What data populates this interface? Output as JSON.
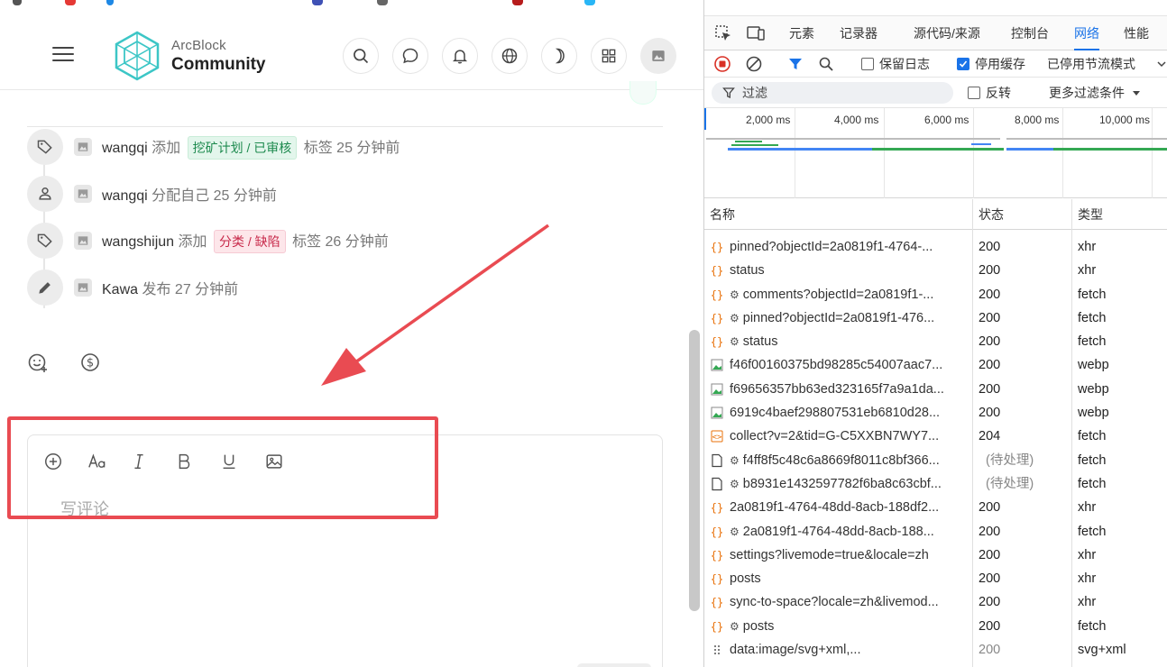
{
  "header": {
    "logo_line1": "ArcBlock",
    "logo_line2": "Community"
  },
  "activity": [
    {
      "icon": "tag-icon",
      "user": "wangqi",
      "before": " 添加 ",
      "tag": "挖矿计划 / 已审核",
      "tag_color": "green",
      "after": " 标签 25 分钟前"
    },
    {
      "icon": "person-icon",
      "user": "wangqi",
      "before": " 分配自己 25 分钟前",
      "tag": "",
      "tag_color": "",
      "after": ""
    },
    {
      "icon": "tag-icon",
      "user": "wangshijun",
      "before": " 添加 ",
      "tag": "分类 / 缺陷",
      "tag_color": "red",
      "after": " 标签 26 分钟前"
    },
    {
      "icon": "pencil-icon",
      "user": "Kawa",
      "before": " 发布 27 分钟前",
      "tag": "",
      "tag_color": "",
      "after": ""
    }
  ],
  "editor": {
    "placeholder": "写评论"
  },
  "devtools": {
    "tabs": [
      "元素",
      "记录器",
      "源代码/来源",
      "控制台",
      "网络",
      "性能"
    ],
    "active_tab": "网络",
    "toolbar": {
      "preserve_log": "保留日志",
      "preserve_log_checked": false,
      "disable_cache": "停用缓存",
      "disable_cache_checked": true,
      "throttling": "已停用节流模式"
    },
    "filter": {
      "placeholder": "过滤",
      "invert": "反转",
      "more_filters": "更多过滤条件"
    },
    "timeline_ticks": [
      "2,000 ms",
      "4,000 ms",
      "6,000 ms",
      "8,000 ms",
      "10,000 ms"
    ],
    "columns": [
      "名称",
      "状态",
      "类型"
    ],
    "requests": [
      {
        "icon": "xhr",
        "gear": false,
        "name": "pinned?objectId=2a0819f1-4764-...",
        "status": "200",
        "type": "xhr"
      },
      {
        "icon": "xhr",
        "gear": false,
        "name": "status",
        "status": "200",
        "type": "xhr"
      },
      {
        "icon": "xhr",
        "gear": true,
        "name": "comments?objectId=2a0819f1-...",
        "status": "200",
        "type": "fetch"
      },
      {
        "icon": "xhr",
        "gear": true,
        "name": "pinned?objectId=2a0819f1-476...",
        "status": "200",
        "type": "fetch"
      },
      {
        "icon": "xhr",
        "gear": true,
        "name": "status",
        "status": "200",
        "type": "fetch"
      },
      {
        "icon": "image",
        "gear": false,
        "name": "f46f00160375bd98285c54007aac7...",
        "status": "200",
        "type": "webp"
      },
      {
        "icon": "image",
        "gear": false,
        "name": "f69656357bb63ed323165f7a9a1da...",
        "status": "200",
        "type": "webp"
      },
      {
        "icon": "image",
        "gear": false,
        "name": "6919c4baef298807531eb6810d28...",
        "status": "200",
        "type": "webp"
      },
      {
        "icon": "script",
        "gear": false,
        "name": "collect?v=2&tid=G-C5XXBN7WY7...",
        "status": "204",
        "type": "fetch"
      },
      {
        "icon": "doc",
        "gear": true,
        "name": "f4ff8f5c48c6a8669f8011c8bf366...",
        "status": "(待处理)",
        "type": "fetch"
      },
      {
        "icon": "doc",
        "gear": true,
        "name": "b8931e1432597782f6ba8c63cbf...",
        "status": "(待处理)",
        "type": "fetch"
      },
      {
        "icon": "xhr",
        "gear": false,
        "name": "2a0819f1-4764-48dd-8acb-188df2...",
        "status": "200",
        "type": "xhr"
      },
      {
        "icon": "xhr",
        "gear": true,
        "name": "2a0819f1-4764-48dd-8acb-188...",
        "status": "200",
        "type": "fetch"
      },
      {
        "icon": "xhr",
        "gear": false,
        "name": "settings?livemode=true&locale=zh",
        "status": "200",
        "type": "xhr"
      },
      {
        "icon": "xhr",
        "gear": false,
        "name": "posts",
        "status": "200",
        "type": "xhr"
      },
      {
        "icon": "xhr",
        "gear": false,
        "name": "sync-to-space?locale=zh&livemod...",
        "status": "200",
        "type": "xhr"
      },
      {
        "icon": "xhr",
        "gear": true,
        "name": "posts",
        "status": "200",
        "type": "fetch"
      },
      {
        "icon": "data",
        "gear": false,
        "name": "data:image/svg+xml,...",
        "status": "200",
        "type": "svg+xml"
      }
    ]
  },
  "colors": {
    "accent": "#1a73e8",
    "annotation_red": "#e94b52",
    "tag_green_bg": "#e3f6ec",
    "tag_red_bg": "#fde6ea"
  }
}
